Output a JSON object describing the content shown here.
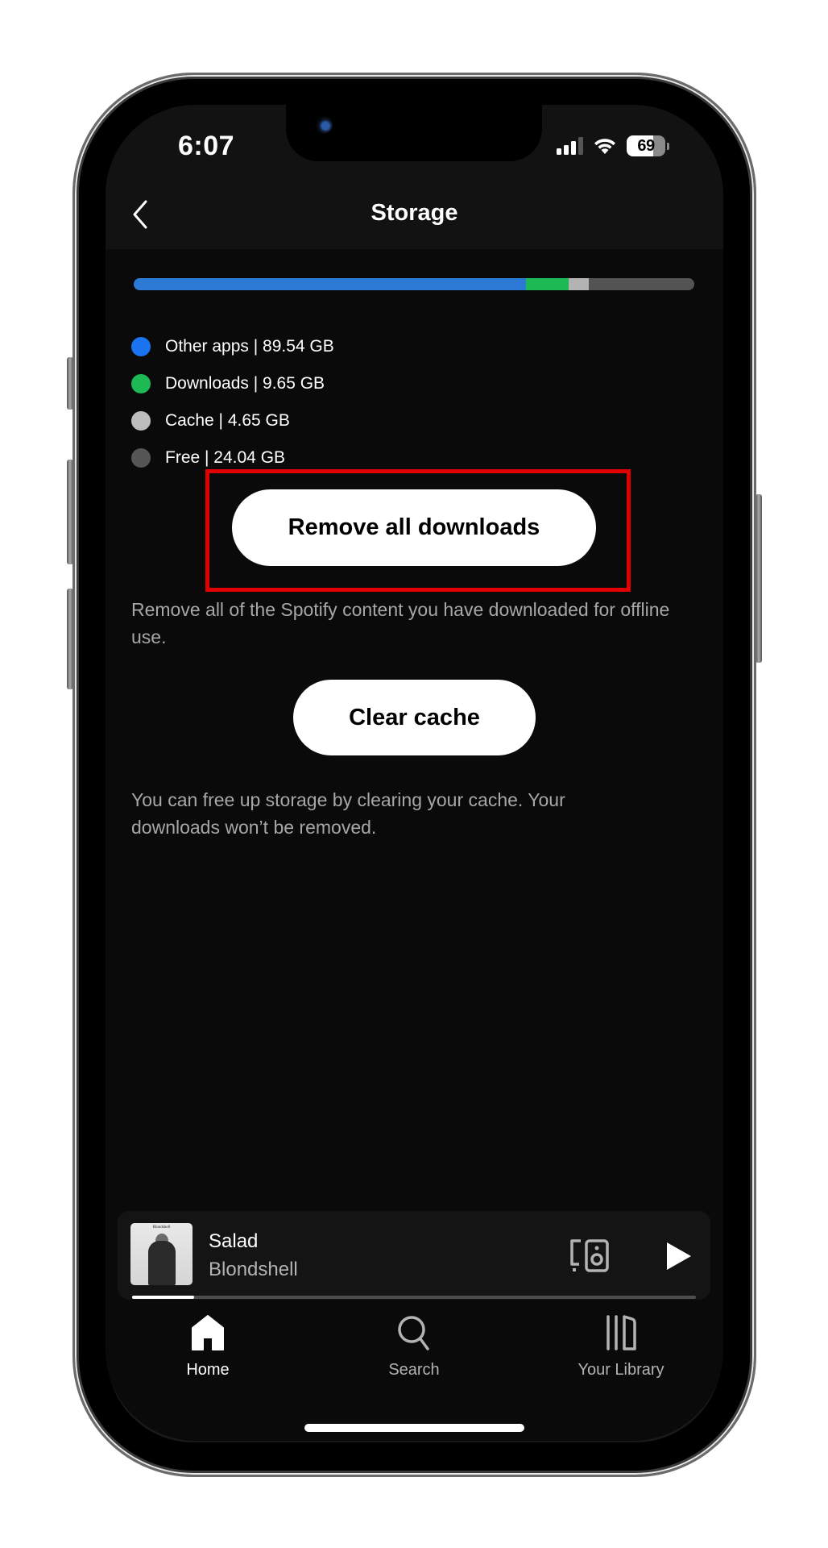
{
  "status_bar": {
    "time": "6:07",
    "signal_bars_active": 3,
    "signal_bars_total": 4,
    "wifi": "connected",
    "battery_level": "69",
    "battery_fraction": 0.69
  },
  "header": {
    "title": "Storage",
    "back_icon": "chevron-left-icon"
  },
  "storage": {
    "unit": "GB",
    "segments": [
      {
        "key": "other_apps",
        "label": "Other apps | 89.54 GB",
        "name": "Other apps",
        "value": 89.54,
        "color": "#2d7ad6",
        "dot_color": "#1a73f0"
      },
      {
        "key": "downloads",
        "label": "Downloads | 9.65 GB",
        "name": "Downloads",
        "value": 9.65,
        "color": "#1db954",
        "dot_color": "#1db954"
      },
      {
        "key": "cache",
        "label": "Cache | 4.65 GB",
        "name": "Cache",
        "value": 4.65,
        "color": "#b3b3b3",
        "dot_color": "#bdbdbd"
      },
      {
        "key": "free",
        "label": "Free | 24.04 GB",
        "name": "Free",
        "value": 24.04,
        "color": "#535353",
        "dot_color": "#555555"
      }
    ]
  },
  "actions": {
    "remove_downloads_label": "Remove all downloads",
    "remove_downloads_desc": "Remove all of the Spotify content you have downloaded for offline use.",
    "clear_cache_label": "Clear cache",
    "clear_cache_desc": "You can free up storage by clearing your cache. Your downloads won’t be removed.",
    "highlight_color": "#e00000"
  },
  "now_playing": {
    "title": "Salad",
    "artist": "Blondshell",
    "album_art_text": "Blondshell",
    "progress_fraction": 0.11,
    "device_icon": "connect-device-icon",
    "play_icon": "play-icon"
  },
  "tabs": [
    {
      "label": "Home",
      "icon": "home-icon",
      "active": true
    },
    {
      "label": "Search",
      "icon": "search-icon",
      "active": false
    },
    {
      "label": "Your Library",
      "icon": "library-icon",
      "active": false
    }
  ]
}
